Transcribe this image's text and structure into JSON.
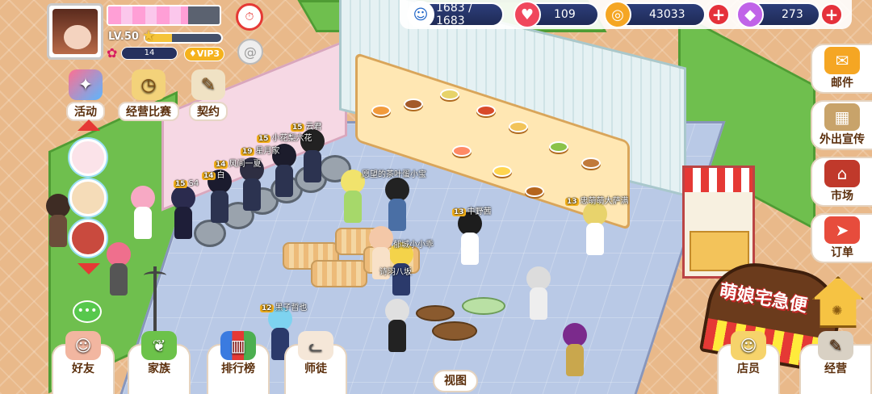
{
  "player": {
    "level": "LV.50",
    "rank_value": "14",
    "vip": "VIP3",
    "energy_fraction": 0.72,
    "exp_fraction": 0.35
  },
  "resources": {
    "stamina": "1683 / 1683",
    "hearts": "109",
    "coins": "43033",
    "gems": "273"
  },
  "left_menu": {
    "activity": "活动",
    "contest": "经营比赛",
    "contract": "契约"
  },
  "right_menu": {
    "mail": "邮件",
    "promote": "外出宣传",
    "market": "市场",
    "orders": "订单"
  },
  "bottom_menu": {
    "friends": "好友",
    "family": "家族",
    "ranking": "排行榜",
    "mentor": "师徒",
    "view": "视图",
    "staff": "店员",
    "manage": "经营"
  },
  "shop_sign": "萌娘宅急便",
  "customers": [
    {
      "lvl": "15",
      "name": "小花梨六花"
    },
    {
      "lvl": "15",
      "name": "云君"
    },
    {
      "lvl": "19",
      "name": "星月家"
    },
    {
      "lvl": "14",
      "name": "风间一夏"
    },
    {
      "lvl": "14",
      "name": "白"
    },
    {
      "lvl": "15",
      "name": "S4"
    },
    {
      "lvl": "",
      "name": "愿望的茶叶蛋小宝"
    },
    {
      "lvl": "13",
      "name": "忠萌萌大萨满"
    },
    {
      "lvl": "13",
      "name": "中野茜"
    },
    {
      "lvl": "",
      "name": "郁城小小乖"
    },
    {
      "lvl": "",
      "name": "诗羽八坂"
    },
    {
      "lvl": "12",
      "name": "黑子哲也"
    }
  ],
  "colors": {
    "heart": "#f0475c",
    "coin": "#f5a623",
    "gem": "#c063e8",
    "plus": "#e5313b",
    "hud_pill": "#25336a"
  },
  "icons": {
    "stamina": "panda-face-icon",
    "hearts": "heart-icon",
    "coins": "coin-icon",
    "gems": "diamond-icon",
    "timer": "stopwatch-icon",
    "chat": "chat-bubble-icon"
  }
}
